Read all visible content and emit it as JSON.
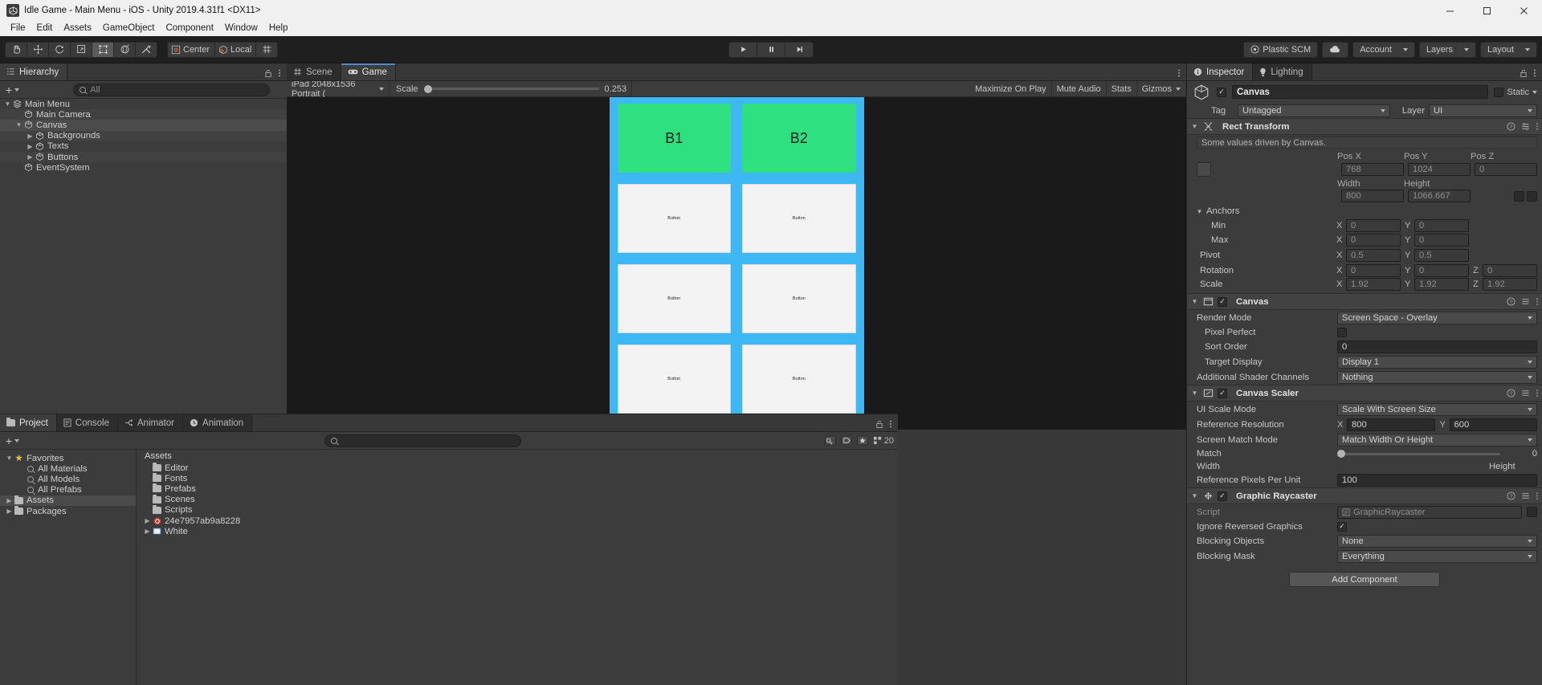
{
  "window": {
    "title": "Idle Game - Main Menu - iOS - Unity 2019.4.31f1 <DX11>",
    "minimize": "–",
    "maximize": "❐",
    "close": "✕"
  },
  "menu": [
    "File",
    "Edit",
    "Assets",
    "GameObject",
    "Component",
    "Window",
    "Help"
  ],
  "toolbar": {
    "tools": [
      "hand-tool",
      "move-tool",
      "rotate-tool",
      "scale-tool",
      "rect-tool",
      "transform-tool",
      "custom-tool"
    ],
    "pivot_mode": "Center",
    "pivot_rotation": "Local",
    "grid_label": "grid-snap",
    "play": "▶",
    "pause": "‖",
    "step": "▶|",
    "plastic_scm": "Plastic SCM",
    "cloud": "cloud-icon",
    "account": "Account",
    "layers": "Layers",
    "layout": "Layout"
  },
  "hierarchy": {
    "tab": "Hierarchy",
    "add_label": "+",
    "search_placeholder": "All",
    "items": [
      {
        "label": "Main Menu",
        "depth": 0,
        "expanded": true,
        "icon": "scene-icon",
        "selected": false
      },
      {
        "label": "Main Camera",
        "depth": 1,
        "expanded": null,
        "icon": "gameobject-icon",
        "selected": false
      },
      {
        "label": "Canvas",
        "depth": 1,
        "expanded": true,
        "icon": "gameobject-icon",
        "selected": true
      },
      {
        "label": "Backgrounds",
        "depth": 2,
        "expanded": false,
        "icon": "gameobject-icon",
        "selected": false
      },
      {
        "label": "Texts",
        "depth": 2,
        "expanded": false,
        "icon": "gameobject-icon",
        "selected": false
      },
      {
        "label": "Buttons",
        "depth": 2,
        "expanded": false,
        "icon": "gameobject-icon",
        "selected": false
      },
      {
        "label": "EventSystem",
        "depth": 1,
        "expanded": null,
        "icon": "gameobject-icon",
        "selected": false
      }
    ]
  },
  "sceneview": {
    "tabs": [
      {
        "label": "Scene",
        "icon": "scene-grid-icon",
        "active": false
      },
      {
        "label": "Game",
        "icon": "gamepad-icon",
        "active": true
      }
    ],
    "aspect": "iPad 2048x1536 Portrait (",
    "scale_label": "Scale",
    "scale_value": "0.253",
    "maximize_on_play": "Maximize On Play",
    "mute_audio": "Mute Audio",
    "stats": "Stats",
    "gizmos": "Gizmos",
    "canvas": {
      "background": "#3db8f5",
      "cells": [
        {
          "label": "B1",
          "style": "green"
        },
        {
          "label": "B2",
          "style": "green"
        },
        {
          "label": "Button",
          "style": "white"
        },
        {
          "label": "Button",
          "style": "white"
        },
        {
          "label": "Button",
          "style": "white"
        },
        {
          "label": "Button",
          "style": "white"
        },
        {
          "label": "Button",
          "style": "white"
        },
        {
          "label": "Button",
          "style": "white"
        }
      ]
    }
  },
  "project": {
    "tabs": [
      {
        "label": "Project",
        "icon": "folder-icon",
        "active": true
      },
      {
        "label": "Console",
        "icon": "console-icon",
        "active": false
      },
      {
        "label": "Animator",
        "icon": "animator-icon",
        "active": false
      },
      {
        "label": "Animation",
        "icon": "animation-clock-icon",
        "active": false
      }
    ],
    "add_label": "+",
    "search_placeholder": "",
    "count_badge": "20",
    "tree": [
      {
        "label": "Favorites",
        "depth": 0,
        "icon": "star-icon",
        "expanded": true
      },
      {
        "label": "All Materials",
        "depth": 1,
        "icon": "search-icon"
      },
      {
        "label": "All Models",
        "depth": 1,
        "icon": "search-icon"
      },
      {
        "label": "All Prefabs",
        "depth": 1,
        "icon": "search-icon"
      },
      {
        "label": "Assets",
        "depth": 0,
        "icon": "folder-icon",
        "expanded": false,
        "selected": true
      },
      {
        "label": "Packages",
        "depth": 0,
        "icon": "folder-icon",
        "expanded": false
      }
    ],
    "breadcrumb": "Assets",
    "files": [
      {
        "label": "Editor",
        "icon": "folder-icon",
        "expandable": false
      },
      {
        "label": "Fonts",
        "icon": "folder-icon",
        "expandable": false
      },
      {
        "label": "Prefabs",
        "icon": "folder-icon",
        "expandable": false
      },
      {
        "label": "Scenes",
        "icon": "folder-icon",
        "expandable": false
      },
      {
        "label": "Scripts",
        "icon": "folder-icon",
        "expandable": false
      },
      {
        "label": "24e7957ab9a8228",
        "icon": "target-icon",
        "expandable": true
      },
      {
        "label": "White",
        "icon": "image-icon",
        "expandable": true
      }
    ]
  },
  "inspector": {
    "tabs": [
      {
        "label": "Inspector",
        "icon": "info-icon",
        "active": true
      },
      {
        "label": "Lighting",
        "icon": "bulb-icon",
        "active": false
      }
    ],
    "object_name": "Canvas",
    "enabled": true,
    "static_label": "Static",
    "tag_label": "Tag",
    "tag_value": "Untagged",
    "layer_label": "Layer",
    "layer_value": "UI",
    "rect_transform": {
      "title": "Rect Transform",
      "note": "Some values driven by Canvas.",
      "pos_labels": [
        "Pos X",
        "Pos Y",
        "Pos Z"
      ],
      "pos_values": [
        "768",
        "1024",
        "0"
      ],
      "size_labels": [
        "Width",
        "Height"
      ],
      "size_values": [
        "800",
        "1066.667"
      ],
      "anchors_label": "Anchors",
      "min_label": "Min",
      "min": {
        "x": "0",
        "y": "0"
      },
      "max_label": "Max",
      "max": {
        "x": "0",
        "y": "0"
      },
      "pivot_label": "Pivot",
      "pivot": {
        "x": "0.5",
        "y": "0.5"
      },
      "rotation_label": "Rotation",
      "rotation": {
        "x": "0",
        "y": "0",
        "z": "0"
      },
      "scale_label": "Scale",
      "scale": {
        "x": "1.92",
        "y": "1.92",
        "z": "1.92"
      }
    },
    "canvas": {
      "title": "Canvas",
      "render_mode_label": "Render Mode",
      "render_mode_value": "Screen Space - Overlay",
      "pixel_perfect_label": "Pixel Perfect",
      "pixel_perfect": false,
      "sort_order_label": "Sort Order",
      "sort_order_value": "0",
      "target_display_label": "Target Display",
      "target_display_value": "Display 1",
      "shader_channels_label": "Additional Shader Channels",
      "shader_channels_value": "Nothing"
    },
    "canvas_scaler": {
      "title": "Canvas Scaler",
      "ui_scale_mode_label": "UI Scale Mode",
      "ui_scale_mode_value": "Scale With Screen Size",
      "reference_resolution_label": "Reference Resolution",
      "reference_resolution": {
        "x": "800",
        "y": "600"
      },
      "screen_match_mode_label": "Screen Match Mode",
      "screen_match_mode_value": "Match Width Or Height",
      "match_label": "Match",
      "match_value": "0",
      "match_min": "Width",
      "match_max": "Height",
      "reference_ppu_label": "Reference Pixels Per Unit",
      "reference_ppu_value": "100"
    },
    "graphic_raycaster": {
      "title": "Graphic Raycaster",
      "script_label": "Script",
      "script_value": "GraphicRaycaster",
      "ignore_reversed_label": "Ignore Reversed Graphics",
      "ignore_reversed": true,
      "blocking_objects_label": "Blocking Objects",
      "blocking_objects_value": "None",
      "blocking_mask_label": "Blocking Mask",
      "blocking_mask_value": "Everything"
    },
    "add_component": "Add Component"
  }
}
